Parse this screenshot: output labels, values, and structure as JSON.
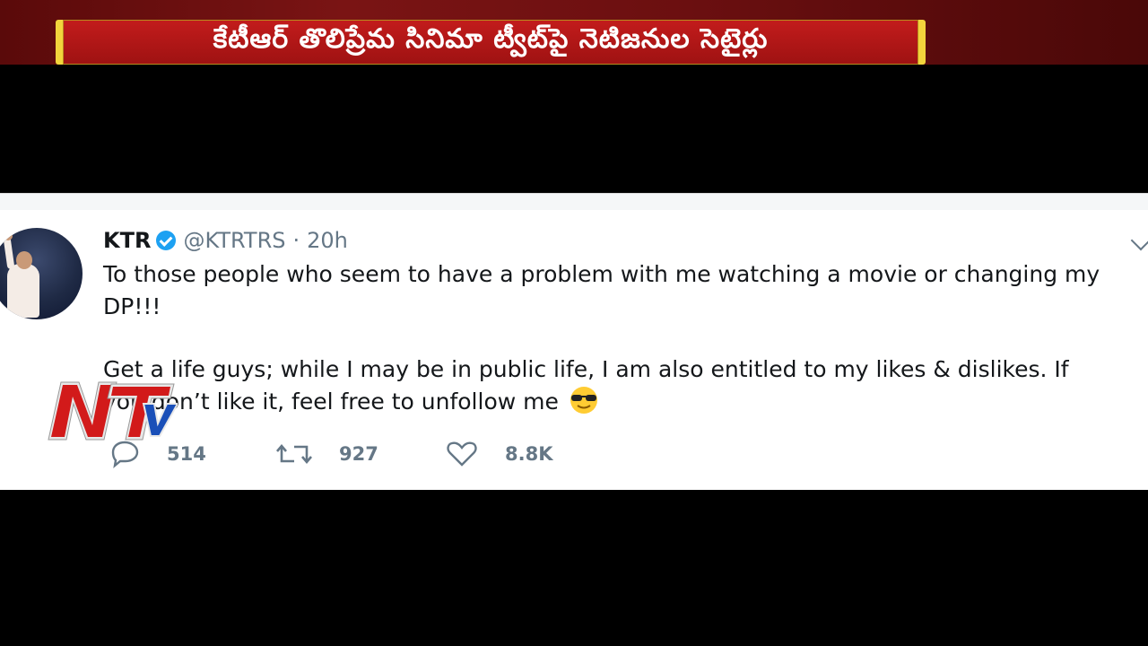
{
  "banner": {
    "headline": "కేటీఆర్ తొలిప్రేమ సినిమా ట్వీట్‌పై నెటిజనుల సెటైర్లు"
  },
  "tweet": {
    "author_name": "KTR",
    "verified_icon": "verified-badge-icon",
    "handle": "@KTRTRS",
    "separator": "·",
    "time": "20h",
    "paragraph1": "To those people who seem to have a problem with me watching a movie or changing my DP!!!",
    "paragraph2": "Get a life guys; while I may be in public life, I am also entitled to my likes & dislikes. If you don’t like it, feel free to unfollow me",
    "emoji": "smiling-face-with-sunglasses-emoji",
    "actions": {
      "replies": "514",
      "retweets": "927",
      "likes": "8.8K"
    }
  },
  "logo": {
    "text": "NTV"
  },
  "colors": {
    "banner_red": "#b71717",
    "banner_gold": "#f2d43c",
    "verified_blue": "#1da1f2",
    "meta_gray": "#657786"
  }
}
